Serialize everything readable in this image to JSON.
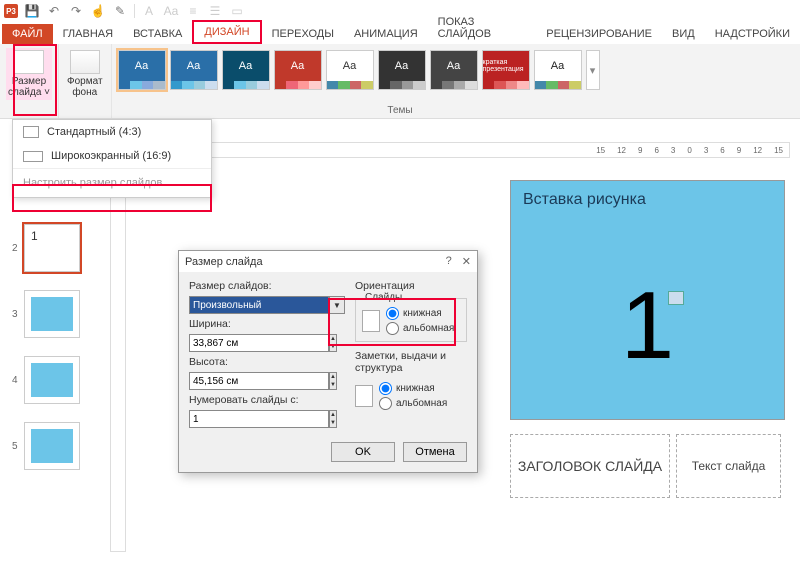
{
  "qat": {
    "app": "P3"
  },
  "tabs": {
    "file": "ФАЙЛ",
    "items": [
      "ГЛАВНАЯ",
      "ВСТАВКА",
      "ДИЗАЙН",
      "ПЕРЕХОДЫ",
      "АНИМАЦИЯ",
      "ПОКАЗ СЛАЙДОВ",
      "РЕЦЕНЗИРОВАНИЕ",
      "ВИД",
      "НАДСТРОЙКИ"
    ]
  },
  "ribbon": {
    "slide_size": "Размер\nслайда ˅",
    "bg_format": "Формат\nфона",
    "themes_label": "Темы",
    "aa": "Aa"
  },
  "dropdown": {
    "std": "Стандартный (4:3)",
    "wide": "Широкоэкранный (16:9)",
    "custom": "Настроить размер слайдов..."
  },
  "ruler": [
    "15",
    "12",
    "9",
    "6",
    "3",
    "0",
    "3",
    "6",
    "9",
    "12",
    "15"
  ],
  "thumbs": {
    "nums": [
      "2",
      "3",
      "4",
      "5"
    ],
    "sel_num": "1"
  },
  "canvas": {
    "title": "Вставка рисунка",
    "big": "1",
    "ph_title": "ЗАГОЛОВОК СЛАЙДА",
    "ph_text": "Текст слайда"
  },
  "dialog": {
    "title": "Размер слайда",
    "help": "?",
    "close": "✕",
    "size_label": "Размер слайдов:",
    "size_value": "Произвольный",
    "width_label": "Ширина:",
    "width_value": "33,867 см",
    "height_label": "Высота:",
    "height_value": "45,156 см",
    "numfrom_label": "Нумеровать слайды с:",
    "numfrom_value": "1",
    "orient_label": "Ориентация",
    "slides_label": "Слайды",
    "notes_label": "Заметки, выдачи и структура",
    "portrait": "книжная",
    "landscape": "альбомная",
    "ok": "OK",
    "cancel": "Отмена"
  }
}
